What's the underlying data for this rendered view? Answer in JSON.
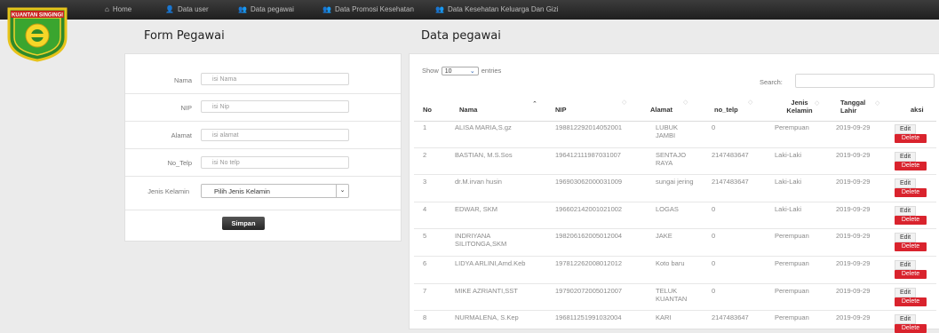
{
  "nav": [
    {
      "icon": "home-icon",
      "glyph": "⌂",
      "label": "Home"
    },
    {
      "icon": "user-icon",
      "glyph": "👤",
      "label": "Data user"
    },
    {
      "icon": "group-icon",
      "glyph": "👥",
      "label": "Data pegawai"
    },
    {
      "icon": "group-icon",
      "glyph": "👥",
      "label": "Data Promosi Kesehatan"
    },
    {
      "icon": "group-icon",
      "glyph": "👥",
      "label": "Data Kesehatan Keluarga Dan Gizi"
    }
  ],
  "logo": {
    "banner": "KUANTAN SINGINGI"
  },
  "form": {
    "title": "Form Pegawai",
    "nama": {
      "label": "Nama",
      "placeholder": "isi Nama"
    },
    "nip": {
      "label": "NIP",
      "placeholder": "isi Nip"
    },
    "alamat": {
      "label": "Alamat",
      "placeholder": "isi alamat"
    },
    "telp": {
      "label": "No_Telp",
      "placeholder": "isi No telp"
    },
    "jk": {
      "label": "Jenis Kelamin",
      "selected": "Pilih Jenis Kelamin"
    },
    "submit": "Simpan"
  },
  "table": {
    "title": "Data pegawai",
    "show_pre": "Show",
    "show_value": "10",
    "show_post": "entries",
    "search_label": "Search:",
    "headers": {
      "no": "No",
      "nama": "Nama",
      "nip": "NIP",
      "alamat": "Alamat",
      "telp": "no_telp",
      "jk": "Jenis Kelamin",
      "tgl": "Tanggal Lahir",
      "aksi": "aksi"
    },
    "edit_label": "Edit",
    "delete_label": "Delete",
    "rows": [
      {
        "no": "1",
        "nama": "ALISA MARIA,S.gz",
        "nip": "198812292014052001",
        "alamat": "LUBUK JAMBI",
        "telp": "0",
        "jk": "Perempuan",
        "tgl": "2019-09-29"
      },
      {
        "no": "2",
        "nama": "BASTIAN, M.S.Sos",
        "nip": "196412111987031007",
        "alamat": "SENTAJO RAYA",
        "telp": "2147483647",
        "jk": "Laki-Laki",
        "tgl": "2019-09-29"
      },
      {
        "no": "3",
        "nama": "dr.M.irvan husin",
        "nip": "196903062000031009",
        "alamat": "sungai jering",
        "telp": "2147483647",
        "jk": "Laki-Laki",
        "tgl": "2019-09-29"
      },
      {
        "no": "4",
        "nama": "EDWAR, SKM",
        "nip": "196602142001021002",
        "alamat": "LOGAS",
        "telp": "0",
        "jk": "Laki-Laki",
        "tgl": "2019-09-29"
      },
      {
        "no": "5",
        "nama": "INDRIYANA SILITONGA,SKM",
        "nip": "198206162005012004",
        "alamat": "JAKE",
        "telp": "0",
        "jk": "Perempuan",
        "tgl": "2019-09-29"
      },
      {
        "no": "6",
        "nama": "LIDYA ARLINI,Amd.Keb",
        "nip": "197812262008012012",
        "alamat": "Koto baru",
        "telp": "0",
        "jk": "Perempuan",
        "tgl": "2019-09-29"
      },
      {
        "no": "7",
        "nama": "MIKE AZRIANTI,SST",
        "nip": "197902072005012007",
        "alamat": "TELUK KUANTAN",
        "telp": "0",
        "jk": "Perempuan",
        "tgl": "2019-09-29"
      },
      {
        "no": "8",
        "nama": "NURMALENA, S.Kep",
        "nip": "196811251991032004",
        "alamat": "KARI",
        "telp": "2147483647",
        "jk": "Perempuan",
        "tgl": "2019-09-29"
      }
    ]
  }
}
